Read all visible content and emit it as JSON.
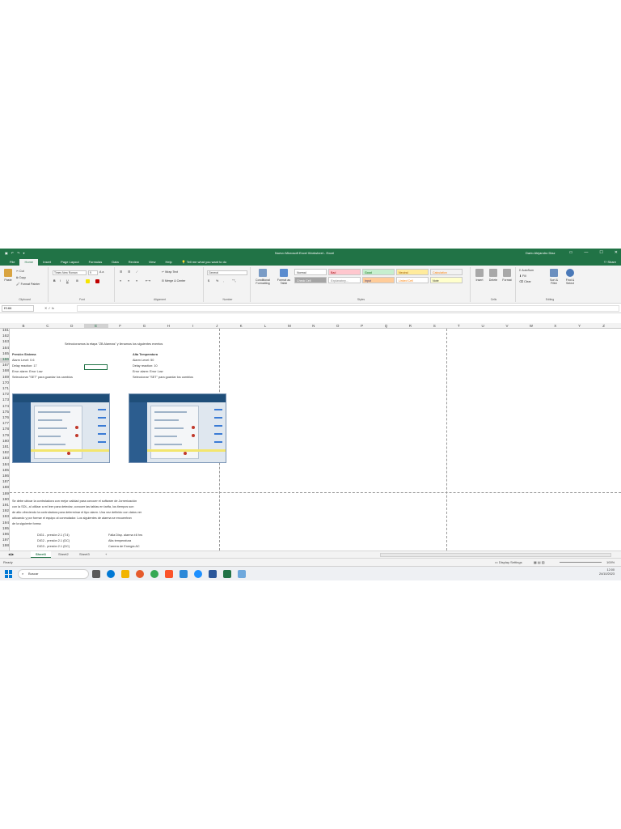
{
  "window": {
    "title": "Nuevo Microsoft Excel Worksheet - Excel",
    "user": "Dario Alejandro Diaz",
    "controls": [
      "▭",
      "—",
      "☐",
      "✕"
    ]
  },
  "ribbon_tabs": [
    "File",
    "Home",
    "Insert",
    "Page Layout",
    "Formulas",
    "Data",
    "Review",
    "View",
    "Help"
  ],
  "active_tab": "Home",
  "tell_me": "Tell me what you want to do",
  "share": "Share",
  "ribbon": {
    "clipboard": {
      "paste": "Paste",
      "cut": "Cut",
      "copy": "Copy",
      "format_painter": "Format Painter",
      "label": "Clipboard"
    },
    "font": {
      "name": "Times New Roman",
      "size": "9",
      "label": "Font",
      "bold": "B",
      "italic": "I",
      "underline": "U"
    },
    "alignment": {
      "wrap": "Wrap Text",
      "merge": "Merge & Center",
      "label": "Alignment"
    },
    "number": {
      "format": "General",
      "currency": "$",
      "percent": "%",
      "comma": ",",
      "label": "Number"
    },
    "styles": {
      "conditional": "Conditional Formatting",
      "format_table": "Format as Table",
      "cells": [
        "Normal",
        "Bad",
        "Good",
        "Neutral",
        "Calculation",
        "Check Cell",
        "Explanatory...",
        "Input",
        "Linked Cell",
        "Note"
      ],
      "label": "Styles"
    },
    "cells": {
      "insert": "Insert",
      "delete": "Delete",
      "format": "Format",
      "label": "Cells"
    },
    "editing": {
      "autosum": "AutoSum",
      "fill": "Fill",
      "clear": "Clear",
      "sort": "Sort & Filter",
      "find": "Find & Select",
      "label": "Editing"
    }
  },
  "formula_bar": {
    "name_box": "E166",
    "fx": "fx",
    "value": ""
  },
  "columns": [
    "B",
    "C",
    "D",
    "E",
    "F",
    "G",
    "H",
    "I",
    "J",
    "K",
    "L",
    "M",
    "N",
    "O",
    "P",
    "Q",
    "R",
    "S",
    "T",
    "U",
    "V",
    "W",
    "X",
    "Y",
    "Z"
  ],
  "selected_column": "E",
  "rows": [
    "161",
    "162",
    "163",
    "164",
    "165",
    "166",
    "167",
    "168",
    "169",
    "170",
    "171",
    "172",
    "173",
    "174",
    "175",
    "176",
    "177",
    "178",
    "179",
    "180",
    "181",
    "182",
    "183",
    "184",
    "185",
    "186",
    "187",
    "188",
    "189",
    "190",
    "191",
    "192",
    "193",
    "194",
    "195",
    "196",
    "197",
    "198"
  ],
  "selected_row": "166",
  "cells": {
    "instruction": "Seleccionamos la etapa \"ZB Alarmas\" y llenamos los siguientes eventos",
    "left_title": "Presión Sistema",
    "left_lines": [
      "Alarm Level: 0.6",
      "Delay reaction: 17",
      "Error alarm: Error Low",
      "Seleccionar \"SET\" para guardar los cambios"
    ],
    "right_title": "Alta Temperatura",
    "right_lines": [
      "Alarm Level: 50",
      "Delay reaction: 10",
      "Error alarm: Error Low",
      "Seleccionar \"SET\" para guardar los cambios"
    ],
    "paragraph": [
      "Se debe ubicar la controladora con mejor calidad para conocer el software de Jornerización",
      "con la SDL, al utilizar a mi leer para detectar, conocer las tablas en tarifa, los tiempos son",
      "de alto ofreciendo la controladora para determinar el tipo alarm. Una vez definido con datos ver",
      "ubicando y por formar el equipo al conmutador. Los siguientes de alarma se encuentran",
      "de la siguiente forma:"
    ],
    "list_left": [
      "DIG1 - presión 2.1 (T.4)",
      "DIG2 - presión 2.1 (DC)",
      "DIG3 - presión 2.1 (DC)"
    ],
    "list_right": [
      "Falla Disp. alarma ±6 hrs",
      "Alta temperatura",
      "Carrera de Energía AC"
    ]
  },
  "sheet_tabs": [
    "Sheet1",
    "Sheet2",
    "Sheet3"
  ],
  "active_sheet": "Sheet1",
  "add_sheet": "+",
  "status": {
    "ready": "Ready",
    "display": "Display Settings",
    "zoom": "100%"
  },
  "taskbar": {
    "search": "Buscar",
    "time": "12:00",
    "date": "24/10/2023"
  }
}
